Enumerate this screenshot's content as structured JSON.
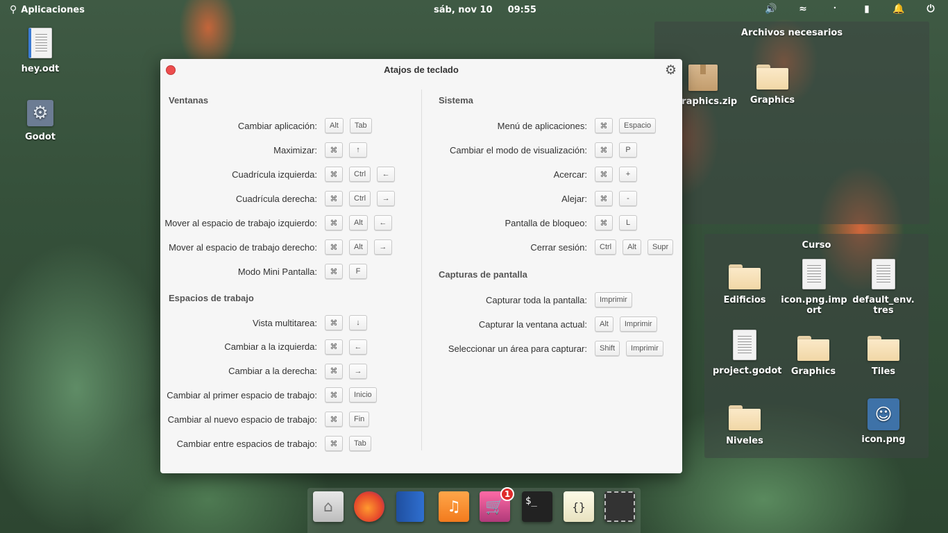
{
  "top_panel": {
    "apps_label": "Aplicaciones",
    "date": "sáb, nov 10",
    "time": "09:55",
    "tray_icons": [
      "volume-icon",
      "wifi-icon",
      "bluetooth-icon",
      "battery-icon",
      "notifications-icon",
      "power-icon"
    ]
  },
  "desktop": {
    "icons": [
      {
        "name": "hey.odt"
      },
      {
        "name": "Godot"
      }
    ]
  },
  "stack_archivos": {
    "title": "Archivos necesarios",
    "items": [
      {
        "name": "graphics.zip"
      },
      {
        "name": "Graphics"
      }
    ]
  },
  "stack_curso": {
    "title": "Curso",
    "items": [
      {
        "name": "Edificios"
      },
      {
        "name": "icon.png.import"
      },
      {
        "name": "default_env.tres"
      },
      {
        "name": "project.godot"
      },
      {
        "name": "Graphics"
      },
      {
        "name": "Tiles"
      },
      {
        "name": "Niveles"
      },
      {
        "name": "icon.png"
      }
    ]
  },
  "window": {
    "title": "Atajos de teclado",
    "sections": {
      "ventanas": {
        "title": "Ventanas",
        "rows": [
          {
            "label": "Cambiar aplicación:",
            "keys": [
              "Alt",
              "Tab"
            ]
          },
          {
            "label": "Maximizar:",
            "keys": [
              "⌘",
              "↑"
            ]
          },
          {
            "label": "Cuadrícula izquierda:",
            "keys": [
              "⌘",
              "Ctrl",
              "←"
            ]
          },
          {
            "label": "Cuadrícula derecha:",
            "keys": [
              "⌘",
              "Ctrl",
              "→"
            ]
          },
          {
            "label": "Mover al espacio de trabajo izquierdo:",
            "keys": [
              "⌘",
              "Alt",
              "←"
            ]
          },
          {
            "label": "Mover al espacio de trabajo derecho:",
            "keys": [
              "⌘",
              "Alt",
              "→"
            ]
          },
          {
            "label": "Modo Mini Pantalla:",
            "keys": [
              "⌘",
              "F"
            ]
          }
        ]
      },
      "espacios": {
        "title": "Espacios de trabajo",
        "rows": [
          {
            "label": "Vista multitarea:",
            "keys": [
              "⌘",
              "↓"
            ]
          },
          {
            "label": "Cambiar a la izquierda:",
            "keys": [
              "⌘",
              "←"
            ]
          },
          {
            "label": "Cambiar a la derecha:",
            "keys": [
              "⌘",
              "→"
            ]
          },
          {
            "label": "Cambiar al primer espacio de trabajo:",
            "keys": [
              "⌘",
              "Inicio"
            ]
          },
          {
            "label": "Cambiar al nuevo espacio de trabajo:",
            "keys": [
              "⌘",
              "Fin"
            ]
          },
          {
            "label": "Cambiar entre espacios de trabajo:",
            "keys": [
              "⌘",
              "Tab"
            ]
          }
        ]
      },
      "sistema": {
        "title": "Sistema",
        "rows": [
          {
            "label": "Menú de aplicaciones:",
            "keys": [
              "⌘",
              "Espacio"
            ]
          },
          {
            "label": "Cambiar el modo de visualización:",
            "keys": [
              "⌘",
              "P"
            ]
          },
          {
            "label": "Acercar:",
            "keys": [
              "⌘",
              "+"
            ]
          },
          {
            "label": "Alejar:",
            "keys": [
              "⌘",
              "-"
            ]
          },
          {
            "label": "Pantalla de bloqueo:",
            "keys": [
              "⌘",
              "L"
            ]
          },
          {
            "label": "Cerrar sesión:",
            "keys": [
              "Ctrl",
              "Alt",
              "Supr"
            ]
          }
        ]
      },
      "capturas": {
        "title": "Capturas de pantalla",
        "rows": [
          {
            "label": "Capturar toda la pantalla:",
            "keys": [
              "Imprimir"
            ]
          },
          {
            "label": "Capturar la ventana actual:",
            "keys": [
              "Alt",
              "Imprimir"
            ]
          },
          {
            "label": "Seleccionar un área para capturar:",
            "keys": [
              "Shift",
              "Imprimir"
            ]
          }
        ]
      }
    }
  },
  "dock": {
    "items": [
      {
        "icon": "files-icon"
      },
      {
        "icon": "firefox-icon"
      },
      {
        "icon": "book-icon"
      },
      {
        "icon": "music-icon"
      },
      {
        "icon": "appcenter-icon",
        "badge": "1"
      },
      {
        "icon": "terminal-icon",
        "text": "$_"
      },
      {
        "icon": "code-icon",
        "text": "{}"
      },
      {
        "icon": "screenshot-icon"
      }
    ]
  }
}
